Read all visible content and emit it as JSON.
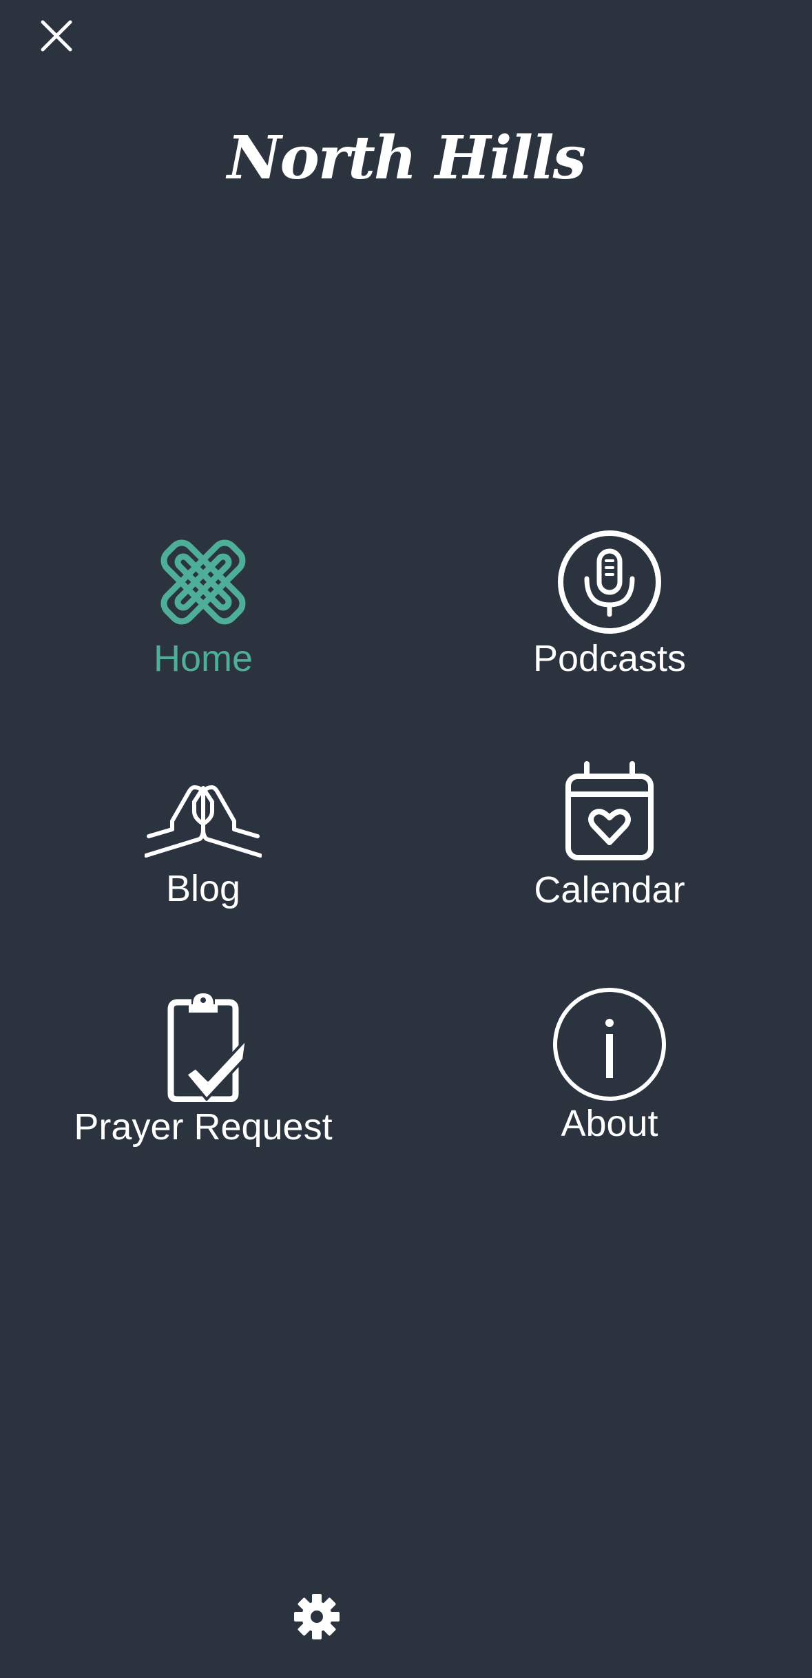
{
  "app": {
    "brand": "North Hills",
    "accent_color": "#4fae98",
    "background_color": "#2a333e"
  },
  "toolbar": {
    "close_icon": "close-icon",
    "settings_icon": "gear-icon"
  },
  "menu": {
    "items": [
      {
        "label": "Home",
        "icon": "north-hills-knot-icon",
        "active": true
      },
      {
        "label": "Podcasts",
        "icon": "microphone-icon",
        "active": false
      },
      {
        "label": "Blog",
        "icon": "praying-hands-icon",
        "active": false
      },
      {
        "label": "Calendar",
        "icon": "calendar-heart-icon",
        "active": false
      },
      {
        "label": "Prayer Request",
        "icon": "clipboard-check-icon",
        "active": false
      },
      {
        "label": "About",
        "icon": "info-icon",
        "active": false
      }
    ]
  }
}
